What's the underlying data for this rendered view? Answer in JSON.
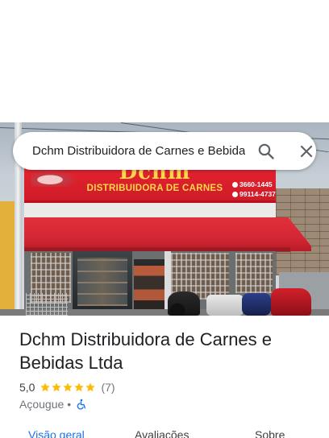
{
  "search": {
    "query": "Dchm Distribuidora de Carnes e Bebidas Ltda"
  },
  "photo": {
    "sign_brand": "Dchm",
    "sign_subtitle": "DISTRIBUIDORA DE CARNES",
    "sign_phone_1": "3660-1445",
    "sign_phone_2": "99114-4737",
    "awning_color": "#d42633",
    "sign_text_color": "#ffd84a"
  },
  "place": {
    "title": "Dchm Distribuidora de Carnes e Bebidas Ltda",
    "rating": "5,0",
    "stars": 5,
    "review_count": "(7)",
    "category": "Açougue",
    "separator": "•",
    "accessibility_icon": "wheelchair-icon"
  },
  "tabs": [
    {
      "label": "Visão geral",
      "active": true
    },
    {
      "label": "Avaliações",
      "active": false
    },
    {
      "label": "Sobre",
      "active": false
    }
  ],
  "colors": {
    "accent": "#1a73e8",
    "star": "#fbbc04",
    "text_primary": "#202124",
    "text_secondary": "#70757a"
  }
}
